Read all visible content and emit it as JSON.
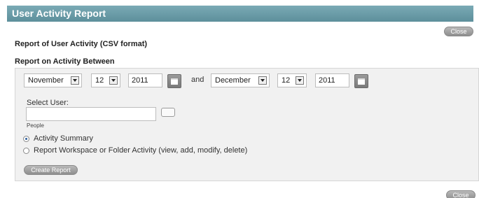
{
  "window": {
    "title": "User Activity Report"
  },
  "buttons": {
    "close": "Close",
    "create_report": "Create Report"
  },
  "report": {
    "title": "Report of User Activity (CSV format)",
    "between_label": "Report on Activity Between"
  },
  "date_range": {
    "from": {
      "month": "November",
      "day": "12",
      "year": "2011"
    },
    "connector": "and",
    "to": {
      "month": "December",
      "day": "12",
      "year": "2011"
    }
  },
  "user": {
    "label": "Select User:",
    "value": "",
    "hint": "People"
  },
  "options": [
    {
      "label": "Activity Summary",
      "checked": true
    },
    {
      "label": "Report Workspace or Folder Activity (view, add, modify, delete)",
      "checked": false
    }
  ]
}
